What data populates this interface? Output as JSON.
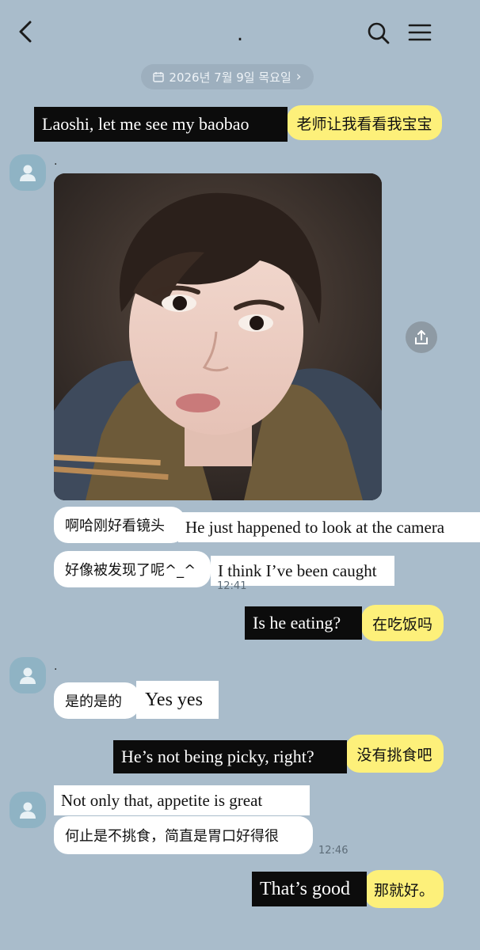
{
  "header": {
    "back_icon": "back-chevron-icon",
    "title": ".",
    "search_icon": "search-icon",
    "menu_icon": "menu-icon"
  },
  "date_pill": {
    "label": "2026년 7월 9일 목요일",
    "chevron": "›"
  },
  "messages": {
    "m1": {
      "subtitle": "Laoshi, let me see my baobao",
      "text": "老师让我看看我宝宝"
    },
    "sender1": {
      "name": "."
    },
    "m2": {
      "text": "啊哈刚好看镜头",
      "subtitle": "He just happened to look at the camera"
    },
    "m3": {
      "text": "好像被发现了呢^_^",
      "subtitle": "I think I’ve been caught",
      "time": "12:41"
    },
    "m4": {
      "subtitle": "Is he eating?",
      "text": "在吃饭吗"
    },
    "sender2": {
      "name": "."
    },
    "m5": {
      "text": "是的是的",
      "subtitle": "Yes yes"
    },
    "m6": {
      "subtitle": "He’s not being picky, right?",
      "text": "没有挑食吧"
    },
    "m7": {
      "subtitle": "Not only that, appetite is great",
      "text": "何止是不挑食，简直是胃口好得很",
      "time": "12:46"
    },
    "m8": {
      "subtitle": "That’s good",
      "text": "那就好。"
    }
  },
  "colors": {
    "background": "#a9bccb",
    "my_bubble": "#fdf07a",
    "their_bubble": "#ffffff",
    "avatar": "#8fb3c4"
  }
}
